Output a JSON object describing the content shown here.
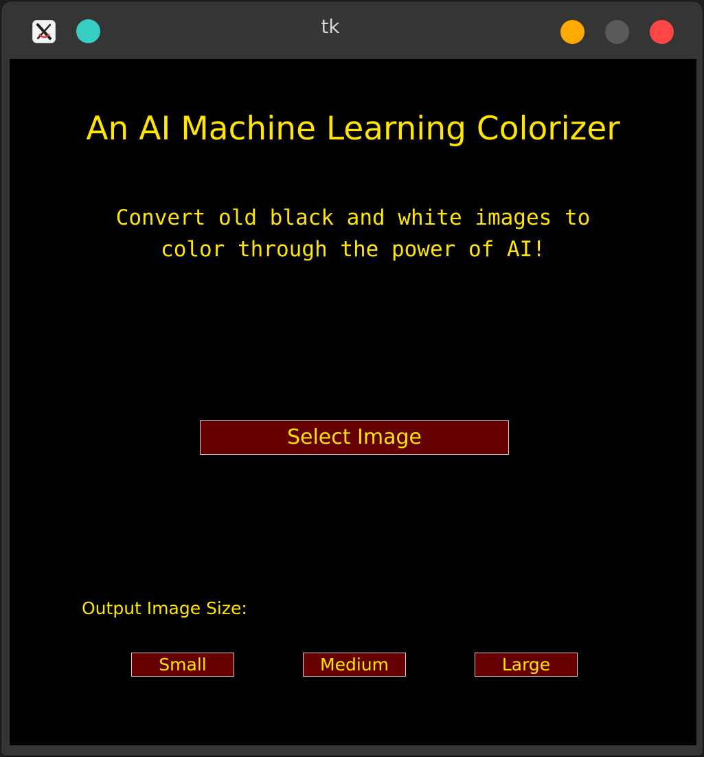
{
  "window": {
    "title": "tk",
    "app_icon": "x11-app-icon",
    "controls": {
      "minimize": "minimize-icon",
      "maximize": "maximize-icon",
      "close": "close-icon"
    },
    "colors": {
      "teal_dot": "#36cdc3",
      "minimize": "#ffaa00",
      "maximize": "#5a5a5a",
      "close": "#ff4646"
    }
  },
  "main": {
    "heading": "An AI Machine Learning Colorizer",
    "subtitle": "Convert old black and white images to color through the power of AI!",
    "select_button": "Select Image",
    "size_label": "Output Image Size:",
    "size_options": [
      "Small",
      "Medium",
      "Large"
    ]
  },
  "colors": {
    "background": "#000000",
    "text": "#ffe500",
    "button_bg": "#660000",
    "button_border": "#e0c8c8"
  }
}
